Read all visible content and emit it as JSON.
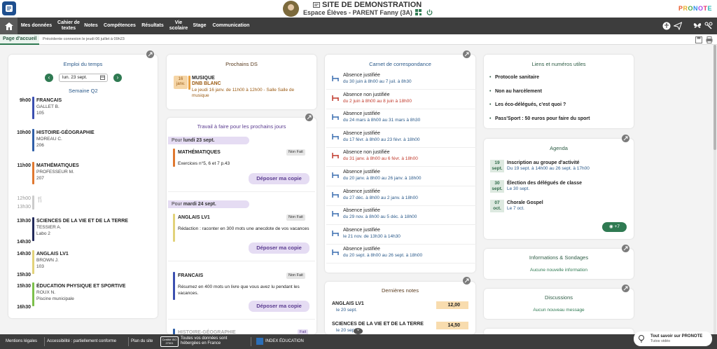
{
  "header": {
    "site_title": "SITE DE DEMONSTRATION",
    "space": "Espace Élèves - PARENT Fanny (3A)",
    "logo": [
      "P",
      "R",
      "O",
      "N",
      "O",
      "T",
      "E"
    ],
    "icons": [
      "app-icon",
      "avatar",
      "document-icon",
      "qr-code-icon",
      "power-icon"
    ]
  },
  "nav": {
    "items": [
      "Mes données",
      "Cahier de textes",
      "Notes",
      "Compétences",
      "Résultats",
      "Vie scolaire",
      "Stage",
      "Communication"
    ]
  },
  "subbar": {
    "tab": "Page d'accueil",
    "last_connection": "Précédente connexion le jeudi 06 juillet à 09h23"
  },
  "edt": {
    "title": "Emploi du temps",
    "date": "lun. 23 sept.",
    "week": "Semaine Q2",
    "courses": [
      {
        "time": "9h00",
        "subject": "FRANCAIS",
        "teacher": "GALLET B.",
        "room": "105",
        "color": "#3b4fb0"
      },
      {
        "time": "10h00",
        "subject": "HISTOIRE-GÉOGRAPHIE",
        "teacher": "MOREAU C.",
        "room": "206",
        "color": "#2f5fa8"
      },
      {
        "time": "11h00",
        "subject": "MATHÉMATIQUES",
        "teacher": "PROFESSEUR M.",
        "room": "207",
        "color": "#e07830"
      },
      {
        "time": "13h30",
        "end": "14h30",
        "subject": "SCIENCES DE LA VIE ET DE LA TERRE",
        "teacher": "TESSIER A.",
        "room": "Labo 2",
        "color": "#222a5a"
      },
      {
        "time": "14h30",
        "end": "15h30",
        "subject": "ANGLAIS LV1",
        "teacher": "BROWN J.",
        "room": "103",
        "color": "#e2d27a"
      },
      {
        "time": "15h30",
        "end": "16h30",
        "subject": "ÉDUCATION PHYSIQUE ET SPORTIVE",
        "teacher": "ROUX N.",
        "room": "Piscine municipale",
        "color": "#7cc04a"
      }
    ],
    "lunch_start": "12h00",
    "lunch_end": "13h30"
  },
  "ds": {
    "title": "Prochains DS",
    "badge": "16 janv.",
    "subject": "MUSIQUE",
    "type": "DNB BLANC",
    "detail": "Le jeudi 16 janv. de 11h00 à 12h00 - Salle Salle de musique"
  },
  "travail": {
    "title": "Travail à faire pour les prochains jours",
    "pour": "Pour",
    "days": [
      {
        "label": "lundi 23 sept.",
        "items": [
          {
            "subject": "MATHÉMATIQUES",
            "status": "Non Fait",
            "desc": "Exercices n°5, 6 et 7 p.43",
            "color": "#e07830"
          }
        ]
      },
      {
        "label": "mardi 24 sept.",
        "items": [
          {
            "subject": "ANGLAIS LV1",
            "status": "Non Fait",
            "desc": "Rédaction : raconter en 300 mots une anecdote de vos vacances",
            "color": "#e2d27a"
          },
          {
            "subject": "FRANCAIS",
            "status": "Non Fait",
            "desc": "Résumez en 400 mots un livre que vous avez lu pendant les vacances.",
            "color": "#3b4fb0"
          },
          {
            "subject": "HISTOIRE-GÉOGRAPHIE",
            "status": "Fait",
            "desc": "",
            "color": "#2f5fa8"
          }
        ]
      }
    ],
    "deposer": "Déposer ma copie"
  },
  "carnet": {
    "title": "Carnet de correspondance",
    "items": [
      {
        "type": "Absence justifiée",
        "detail": "du 30 juin à 8h00 au 7 juil. à 8h30",
        "warn": false
      },
      {
        "type": "Absence non justifiée",
        "detail": "du 2 juin à 8h00 au 8 juin à 18h00",
        "warn": true
      },
      {
        "type": "Absence justifiée",
        "detail": "du 24 mars à 8h00 au 31 mars à 8h30",
        "warn": false
      },
      {
        "type": "Absence justifiée",
        "detail": "du 17 févr. à 8h00 au 23 févr. à 18h00",
        "warn": false
      },
      {
        "type": "Absence non justifiée",
        "detail": "du 31 janv. à 8h00 au 6 févr. à 18h00",
        "warn": true
      },
      {
        "type": "Absence justifiée",
        "detail": "du 20 janv. à 8h00 au 26 janv. à 18h00",
        "warn": false
      },
      {
        "type": "Absence justifiée",
        "detail": "du 27 déc. à 8h00 au 2 janv. à 18h00",
        "warn": false
      },
      {
        "type": "Absence justifiée",
        "detail": "du 29 nov. à 8h00 au 5 déc. à 18h00",
        "warn": false
      },
      {
        "type": "Absence justifiée",
        "detail": "le 21 nov. de 13h30 à 14h30",
        "warn": false
      },
      {
        "type": "Absence justifiée",
        "detail": "du 20 sept. à 8h00 au 26 sept. à 18h00",
        "warn": false
      }
    ]
  },
  "notes": {
    "title": "Dernières notes",
    "items": [
      {
        "subject": "ANGLAIS LV1",
        "date": "le 20 sept.",
        "value": "12,00"
      },
      {
        "subject": "SCIENCES DE LA VIE ET DE LA TERRE",
        "date": "le 20 sept.",
        "value": "14,50"
      }
    ]
  },
  "liens": {
    "title": "Liens et numéros utiles",
    "items": [
      "Protocole sanitaire",
      "Non au harcèlement",
      "Les éco-délégués, c'est quoi ?",
      "Pass'Sport : 50 euros pour faire du sport"
    ]
  },
  "agenda": {
    "title": "Agenda",
    "items": [
      {
        "day": "19",
        "month": "sept.",
        "title": "Inscription au groupe d'activité",
        "detail": "Du 19 sept. à 14h00 au 26 sept. à 17h00"
      },
      {
        "day": "30",
        "month": "sept.",
        "title": "Élection des délégués de classe",
        "detail": "Le 30 sept."
      },
      {
        "day": "07",
        "month": "oct.",
        "title": "Chorale Gospel",
        "detail": "Le 7 oct."
      }
    ],
    "more": "+7"
  },
  "infos": {
    "title": "Informations & Sondages",
    "empty": "Aucune nouvelle information"
  },
  "discussions": {
    "title": "Discussions",
    "empty": "Aucun nouveau message"
  },
  "footer": {
    "mentions": "Mentions légales",
    "access": "Accessibilité : partiellement conforme",
    "plan": "Plan du site",
    "cert_badge": "Certifié ISO 27001",
    "hosting": "Toutes vos données sont hébergées en France",
    "index": "INDEX ÉDUCATION",
    "help_title": "Tout savoir sur PRONOTE",
    "help_sub": "Tutos vidéo"
  },
  "colors": {
    "accent": "#2f7a52",
    "nav": "#3d3d3d",
    "purple": "#e5dcf3",
    "title_blue": "#2b5a8a"
  }
}
